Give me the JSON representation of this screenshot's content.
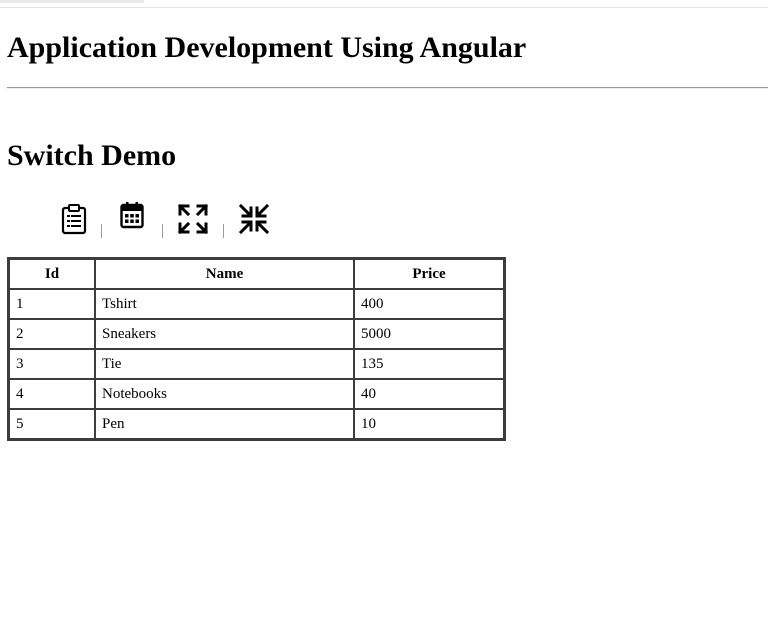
{
  "page": {
    "title": "Application Development Using Angular",
    "subtitle": "Switch Demo"
  },
  "toolbar": {
    "icons": [
      "clipboard-icon",
      "calendar-icon",
      "expand-icon",
      "compress-icon"
    ],
    "separator": "|"
  },
  "table": {
    "headers": [
      "Id",
      "Name",
      "Price"
    ],
    "rows": [
      [
        "1",
        "Tshirt",
        "400"
      ],
      [
        "2",
        "Sneakers",
        "5000"
      ],
      [
        "3",
        "Tie",
        "135"
      ],
      [
        "4",
        "Notebooks",
        "40"
      ],
      [
        "5",
        "Pen",
        "10"
      ]
    ]
  }
}
